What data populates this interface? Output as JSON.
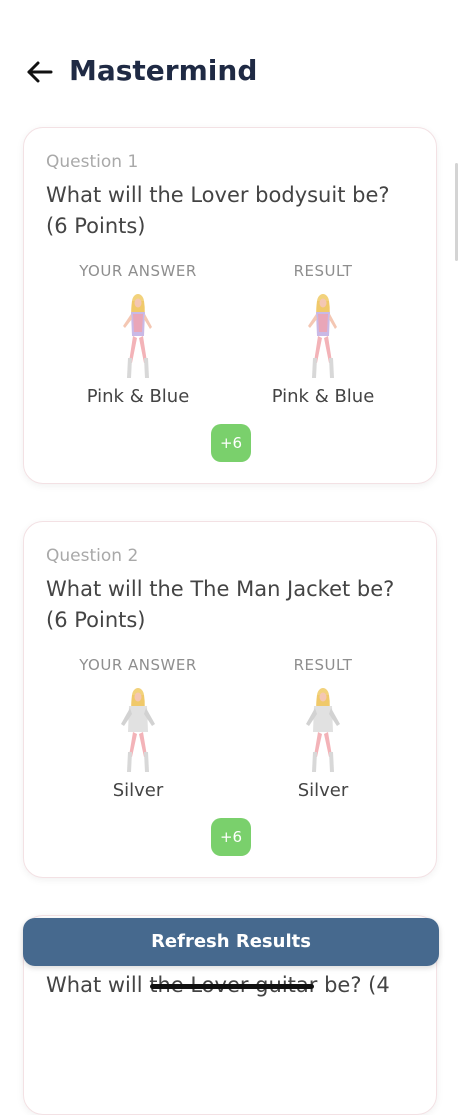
{
  "header": {
    "back_icon": "arrow-left-icon",
    "title": "Mastermind"
  },
  "questions": [
    {
      "number_label": "Question 1",
      "text": "What will the Lover bodysuit be? (6 Points)",
      "your_answer_header": "YOUR ANSWER",
      "result_header": "RESULT",
      "your_answer": "Pink & Blue",
      "result": "Pink & Blue",
      "your_answer_image": "lover-bodysuit-pink-blue-figure",
      "result_image": "lover-bodysuit-pink-blue-figure",
      "points": "+6"
    },
    {
      "number_label": "Question 2",
      "text": "What will the The Man Jacket be? (6 Points)",
      "your_answer_header": "YOUR ANSWER",
      "result_header": "RESULT",
      "your_answer": "Silver",
      "result": "Silver",
      "your_answer_image": "man-jacket-silver-figure",
      "result_image": "man-jacket-silver-figure",
      "points": "+6"
    },
    {
      "text": "What will the Lover guitar be? (4"
    }
  ],
  "refresh_button": "Refresh Results",
  "colors": {
    "title": "#1f2a44",
    "points_badge": "#7ad06c",
    "refresh_button": "#46698e",
    "card_border": "#f3e1e4"
  }
}
